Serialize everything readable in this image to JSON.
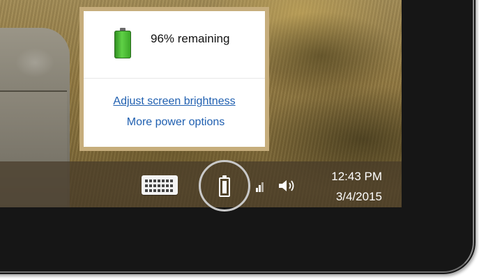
{
  "battery_flyout": {
    "remaining_text": "96% remaining",
    "battery_level_percent": 96,
    "adjust_brightness_label": "Adjust screen brightness",
    "more_power_label": "More power options"
  },
  "taskbar": {
    "icons": [
      "keyboard-icon",
      "battery-icon",
      "network-signal-icon",
      "volume-icon"
    ],
    "time": "12:43 PM",
    "date": "3/4/2015"
  },
  "colors": {
    "flyout_border": "#c6ad7c",
    "link": "#1f5fb0",
    "battery_green": "#5fd146",
    "bezel": "#161616",
    "highlight_ring": "#c9c9c9"
  }
}
